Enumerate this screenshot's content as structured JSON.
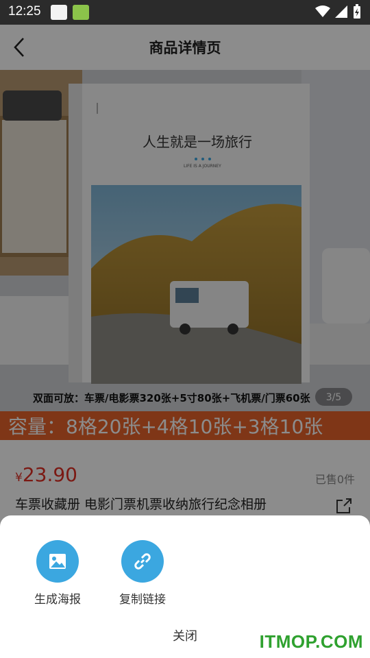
{
  "status_bar": {
    "time": "12:25"
  },
  "nav": {
    "title": "商品详情页"
  },
  "product": {
    "book_cover_title": "人生就是一场旅行",
    "book_cover_subtitle": "LIFE IS A JOURNEY",
    "caption": "双面可放：车票/电影票320张+5寸80张+飞机票/门票60张",
    "image_counter": "3/5",
    "capacity_banner": "容量：8格20张+4格10张+3格10张",
    "currency": "¥",
    "price": "23.90",
    "sold": "已售0件",
    "title": "车票收藏册 电影门票机票收纳旅行纪念相册"
  },
  "share_sheet": {
    "options": [
      {
        "label": "生成海报",
        "icon": "image-icon"
      },
      {
        "label": "复制链接",
        "icon": "link-icon"
      }
    ],
    "close_label": "关闭"
  },
  "watermark": "ITMOP.COM",
  "colors": {
    "price": "#e02e24",
    "accent": "#3ba7e0",
    "banner": "#e8632a"
  }
}
